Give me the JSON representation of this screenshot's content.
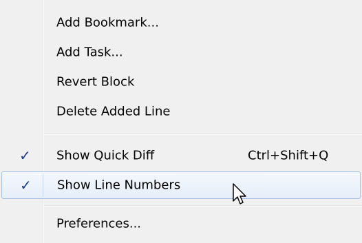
{
  "menu": {
    "items": [
      {
        "label": "Add Bookmark..."
      },
      {
        "label": "Add Task..."
      },
      {
        "label": "Revert Block"
      },
      {
        "label": "Delete Added Line"
      },
      {
        "label": "Show Quick Diff",
        "checked": true,
        "shortcut": "Ctrl+Shift+Q"
      },
      {
        "label": "Show Line Numbers",
        "checked": true,
        "hovered": true
      },
      {
        "label": "Preferences..."
      }
    ],
    "check_glyph": "✓",
    "accent_check_color": "#1a3d8f",
    "hover_border_color": "#a7c1e0",
    "background_color": "#f0f0f0"
  },
  "cursor": {
    "icon": "arrow-pointer-icon"
  }
}
